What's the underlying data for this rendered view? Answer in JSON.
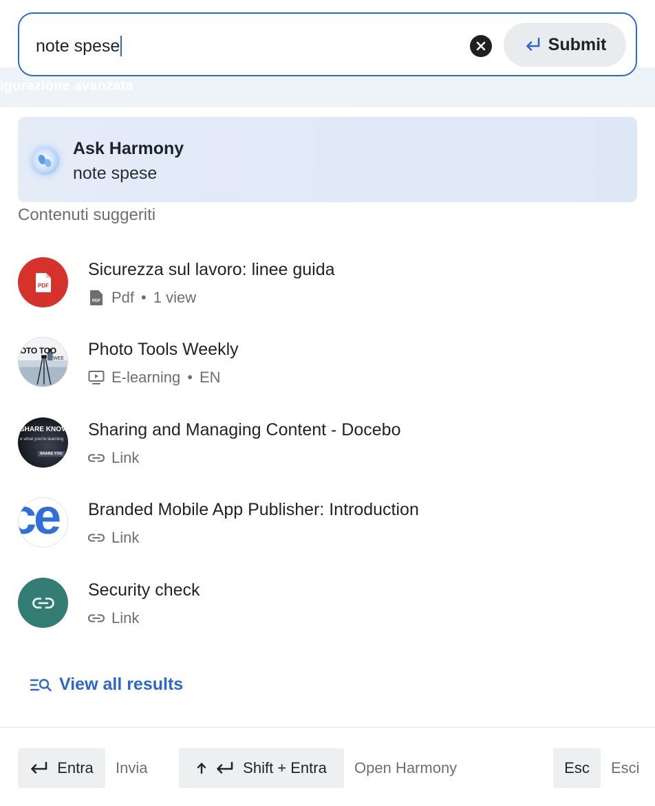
{
  "search": {
    "value": "note spese",
    "clear_label": "clear",
    "submit_label": "Submit"
  },
  "background": {
    "band_text": "igurazione avanzata"
  },
  "ask": {
    "title": "Ask Harmony",
    "query": "note spese"
  },
  "suggested": {
    "heading": "Contenuti suggeriti",
    "items": [
      {
        "title": "Sicurezza sul lavoro: linee guida",
        "type": "Pdf",
        "extra": "1 view",
        "thumb_icon": "pdf-icon",
        "meta_icon": "pdf-file-icon",
        "thumb_color": "#d5322b"
      },
      {
        "title": "Photo Tools Weekly",
        "type": "E-learning",
        "extra": "EN",
        "thumb_icon": "photo-thumbnail",
        "meta_icon": "monitor-play-icon",
        "thumb_text": "OTO TOO",
        "thumb_sub": "WEE"
      },
      {
        "title": "Sharing and Managing Content - Docebo",
        "type": "Link",
        "extra": "",
        "thumb_icon": "share-knowledge-thumbnail",
        "meta_icon": "link-icon",
        "thumb_text": "SHARE KNOV",
        "thumb_sub": "e what you're learning",
        "thumb_sub2": "SHARE YOU"
      },
      {
        "title": "Branded Mobile App Publisher: Introduction",
        "type": "Link",
        "extra": "",
        "thumb_icon": "ce-logo-thumbnail",
        "meta_icon": "link-icon",
        "thumb_text": "ce"
      },
      {
        "title": "Security check",
        "type": "Link",
        "extra": "",
        "thumb_icon": "link-icon",
        "meta_icon": "link-icon",
        "thumb_color": "#347d74"
      }
    ],
    "separator": "•"
  },
  "view_all": {
    "label": "View all results"
  },
  "footer": {
    "enter_key": "Entra",
    "enter_desc": "Invia",
    "shift_key": "Shift + Entra",
    "shift_desc": "Open Harmony",
    "esc_key": "Esc",
    "esc_desc": "Esci"
  },
  "colors": {
    "accent": "#2c66d1",
    "pdf": "#d5322b",
    "link_thumb": "#347d74"
  }
}
